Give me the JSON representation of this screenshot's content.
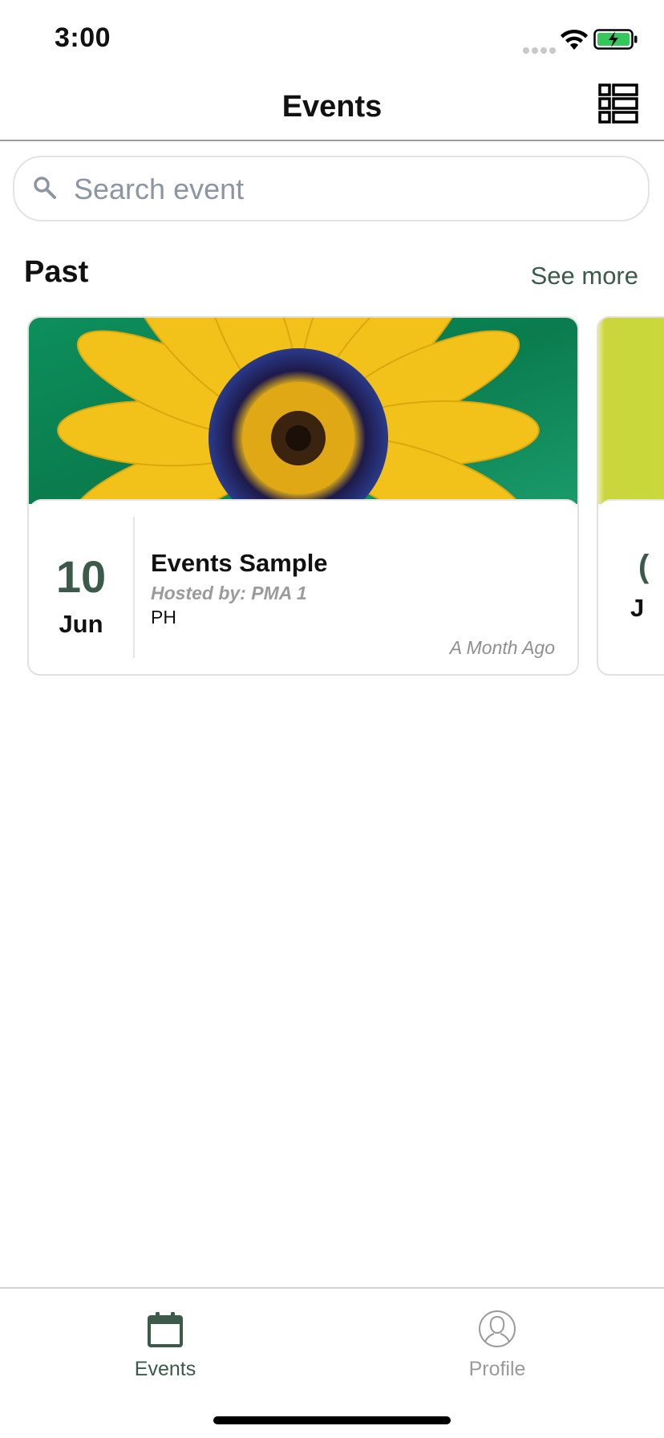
{
  "status_bar": {
    "time": "3:00",
    "icons": [
      "signal-dots-icon",
      "wifi-icon",
      "battery-charging-icon"
    ]
  },
  "nav": {
    "title": "Events",
    "right_icon": "list-view-icon"
  },
  "search": {
    "placeholder": "Search event",
    "value": "",
    "icon": "search-icon"
  },
  "section": {
    "title": "Past",
    "see_more_label": "See more"
  },
  "events": [
    {
      "day": "10",
      "month": "Jun",
      "title": "Events Sample",
      "host": "Hosted by: PMA 1",
      "location": "PH",
      "relative_time": "A Month Ago",
      "image": "yellow-flower-photo"
    }
  ],
  "peek_card": {
    "day": "(",
    "month": "J",
    "image_color": "#c9d83a"
  },
  "tabs": [
    {
      "label": "Events",
      "icon": "calendar-icon",
      "active": true
    },
    {
      "label": "Profile",
      "icon": "user-profile-icon",
      "active": false
    }
  ],
  "colors": {
    "accent": "#3b5a4a",
    "inactive": "#9a9a9a",
    "placeholder": "#8c96a3"
  }
}
